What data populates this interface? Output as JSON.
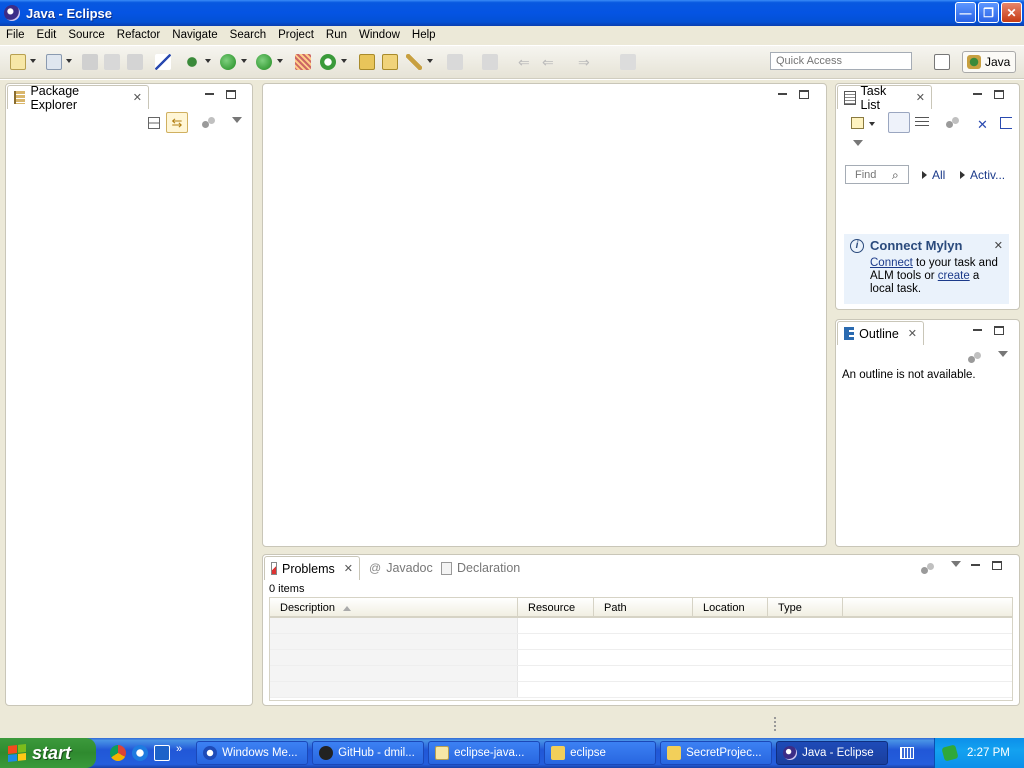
{
  "window": {
    "title": "Java - Eclipse",
    "minimize": "—",
    "restore": "❐",
    "close": "✕"
  },
  "menu": [
    "File",
    "Edit",
    "Source",
    "Refactor",
    "Navigate",
    "Search",
    "Project",
    "Run",
    "Window",
    "Help"
  ],
  "toolbar": {
    "quick_access_placeholder": "Quick Access",
    "perspective_label": "Java"
  },
  "package_explorer": {
    "tab_label": "Package Explorer"
  },
  "task_list": {
    "tab_label": "Task List",
    "find_placeholder": "Find",
    "filter_all": "All",
    "filter_active": "Activ..."
  },
  "mylyn": {
    "title": "Connect Mylyn",
    "link_connect": "Connect",
    "text_mid": " to your task and ALM tools or ",
    "link_create": "create",
    "text_end": " a local task."
  },
  "outline": {
    "tab_label": "Outline",
    "message": "An outline is not available."
  },
  "bottom_panel": {
    "tabs": [
      "Problems",
      "Javadoc",
      "Declaration"
    ],
    "item_count": "0 items",
    "columns": [
      "Description",
      "Resource",
      "Path",
      "Location",
      "Type"
    ]
  },
  "taskbar": {
    "start_label": "start",
    "more": "»",
    "buttons": [
      "Windows Me...",
      "GitHub - dmil...",
      "eclipse-java...",
      "eclipse",
      "SecretProjec...",
      "Java - Eclipse"
    ],
    "clock": "2:27 PM"
  }
}
